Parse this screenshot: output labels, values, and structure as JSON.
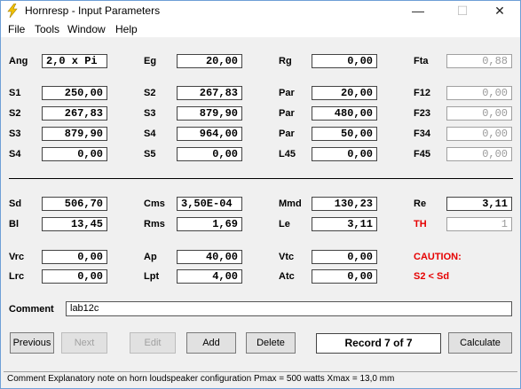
{
  "window": {
    "title": "Hornresp - Input Parameters",
    "minimize": "—",
    "maximize": "☐",
    "close": "✕"
  },
  "menu": [
    "File",
    "Tools",
    "Window",
    "Help"
  ],
  "params": {
    "Ang": "2,0 x Pi",
    "Eg": "20,00",
    "Rg": "0,00",
    "Fta": "0,88",
    "S1": "250,00",
    "S2a": "267,83",
    "Par1": "20,00",
    "F12": "0,00",
    "S2": "267,83",
    "S3a": "879,90",
    "Par2": "480,00",
    "F23": "0,00",
    "S3": "879,90",
    "S4a": "964,00",
    "Par3": "50,00",
    "F34": "0,00",
    "S4": "0,00",
    "S5": "0,00",
    "L45": "0,00",
    "F45": "0,00",
    "Sd": "506,70",
    "Cms": "3,50E-04",
    "Mmd": "130,23",
    "Re": "3,11",
    "Bl": "13,45",
    "Rms": "1,69",
    "Le": "3,11",
    "TH": "1",
    "Vrc": "0,00",
    "Ap": "40,00",
    "Vtc": "0,00",
    "Lrc": "0,00",
    "Lpt": "4,00",
    "Atc": "0,00"
  },
  "labels": {
    "Ang": "Ang",
    "Eg": "Eg",
    "Rg": "Rg",
    "Fta": "Fta",
    "S1": "S1",
    "S2a": "S2",
    "Par1": "Par",
    "F12": "F12",
    "S2": "S2",
    "S3a": "S3",
    "Par2": "Par",
    "F23": "F23",
    "S3": "S3",
    "S4a": "S4",
    "Par3": "Par",
    "F34": "F34",
    "S4": "S4",
    "S5": "S5",
    "L45": "L45",
    "F45": "F45",
    "Sd": "Sd",
    "Cms": "Cms",
    "Mmd": "Mmd",
    "Re": "Re",
    "Bl": "Bl",
    "Rms": "Rms",
    "Le": "Le",
    "TH": "TH",
    "Vrc": "Vrc",
    "Ap": "Ap",
    "Vtc": "Vtc",
    "Lrc": "Lrc",
    "Lpt": "Lpt",
    "Atc": "Atc",
    "caution": "CAUTION:",
    "warning": "S2 < Sd",
    "comment": "Comment"
  },
  "comment_value": "lab12c",
  "buttons": {
    "previous": "Previous",
    "next": "Next",
    "edit": "Edit",
    "add": "Add",
    "delete": "Delete",
    "calculate": "Calculate"
  },
  "record": "Record 7 of 7",
  "status": "Comment   Explanatory note on horn loudspeaker configuration   Pmax = 500 watts   Xmax = 13,0 mm",
  "colors": {
    "warning": "#e60000",
    "title_icon": "#f2c200"
  }
}
